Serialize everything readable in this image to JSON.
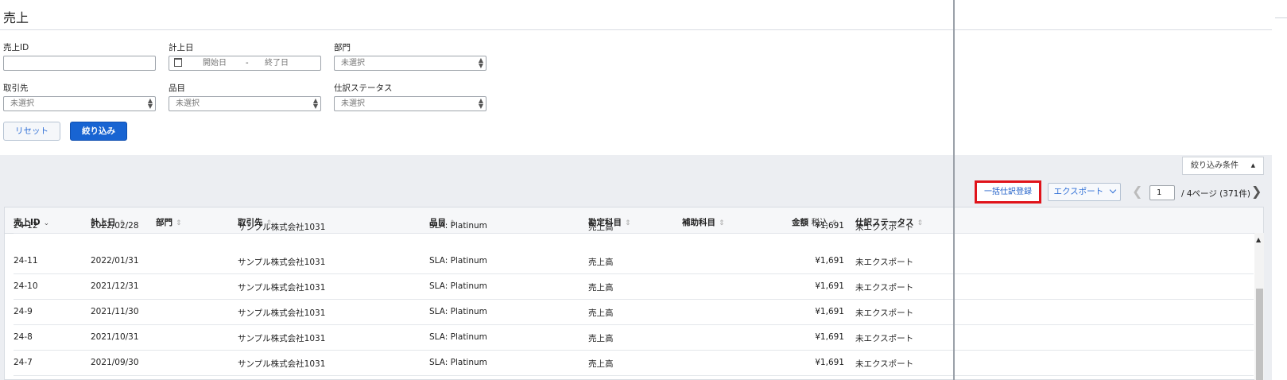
{
  "page": {
    "title": "売上"
  },
  "filters": {
    "sales_id": {
      "label": "売上ID",
      "value": ""
    },
    "date": {
      "label": "計上日",
      "start_placeholder": "開始日",
      "separator": "-",
      "end_placeholder": "終了日"
    },
    "department": {
      "label": "部門",
      "value": "未選択"
    },
    "customer": {
      "label": "取引先",
      "value": "未選択"
    },
    "item": {
      "label": "品目",
      "value": "未選択"
    },
    "journal_status": {
      "label": "仕訳ステータス",
      "value": "未選択"
    },
    "reset_label": "リセット",
    "apply_label": "絞り込み"
  },
  "toolbar": {
    "filter_conditions_label": "絞り込み条件",
    "filter_conditions_icon": "triangle-up-icon",
    "bulk_journal_label": "一括仕訳登録",
    "export_label": "エクスポート",
    "export_icon": "chevron-down-icon",
    "highlight_color": "#e0131a",
    "accent_color": "#1864d2"
  },
  "pager": {
    "current_page": "1",
    "summary": "/ 4ページ (371件)"
  },
  "table": {
    "columns": [
      {
        "label": "売上ID"
      },
      {
        "label": "計上日"
      },
      {
        "label": "部門"
      },
      {
        "label": "取引先"
      },
      {
        "label": "品目"
      },
      {
        "label": "勘定科目"
      },
      {
        "label": "補助科目"
      },
      {
        "label": "金額",
        "sub": "税込"
      },
      {
        "label": "仕訳ステータス"
      }
    ],
    "rows": [
      {
        "id": "24-12",
        "date": "2022/02/28",
        "dept": "",
        "customer": "サンプル株式会社1031",
        "item": "SLA: Platinum",
        "account": "売上高",
        "sub_account": "",
        "amount": "¥1,691",
        "status": "未エクスポート"
      },
      {
        "id": "24-11",
        "date": "2022/01/31",
        "dept": "",
        "customer": "サンプル株式会社1031",
        "item": "SLA: Platinum",
        "account": "売上高",
        "sub_account": "",
        "amount": "¥1,691",
        "status": "未エクスポート"
      },
      {
        "id": "24-10",
        "date": "2021/12/31",
        "dept": "",
        "customer": "サンプル株式会社1031",
        "item": "SLA: Platinum",
        "account": "売上高",
        "sub_account": "",
        "amount": "¥1,691",
        "status": "未エクスポート"
      },
      {
        "id": "24-9",
        "date": "2021/11/30",
        "dept": "",
        "customer": "サンプル株式会社1031",
        "item": "SLA: Platinum",
        "account": "売上高",
        "sub_account": "",
        "amount": "¥1,691",
        "status": "未エクスポート"
      },
      {
        "id": "24-8",
        "date": "2021/10/31",
        "dept": "",
        "customer": "サンプル株式会社1031",
        "item": "SLA: Platinum",
        "account": "売上高",
        "sub_account": "",
        "amount": "¥1,691",
        "status": "未エクスポート"
      },
      {
        "id": "24-7",
        "date": "2021/09/30",
        "dept": "",
        "customer": "サンプル株式会社1031",
        "item": "SLA: Platinum",
        "account": "売上高",
        "sub_account": "",
        "amount": "¥1,691",
        "status": "未エクスポート"
      }
    ]
  }
}
